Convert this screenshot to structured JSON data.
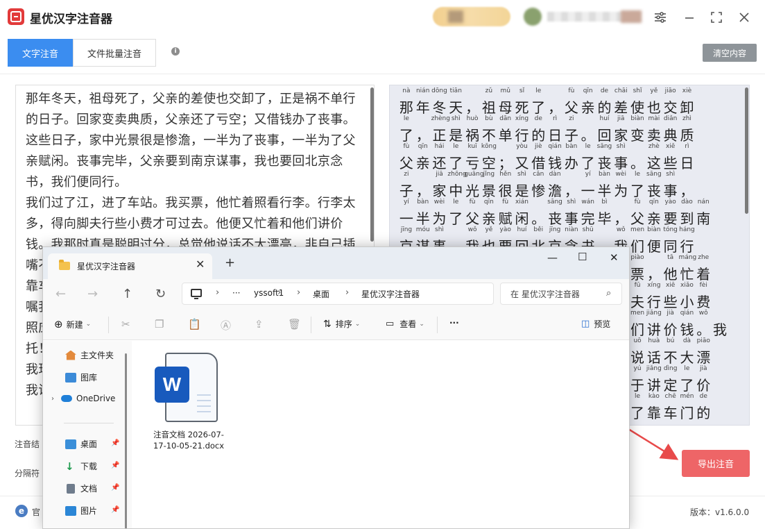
{
  "app": {
    "title": "星优汉字注音器",
    "tabs": [
      {
        "label": "文字注音",
        "active": true
      },
      {
        "label": "文件批量注音",
        "active": false
      }
    ],
    "clear_label": "清空内容",
    "export_label": "导出注音",
    "label_result": "注音结",
    "label_separator": "分隔符",
    "official_site": "官",
    "version": "版本：v1.6.0.0",
    "window_icons": [
      "settings-icon",
      "minimize-icon",
      "maximize-icon",
      "close-icon"
    ],
    "colors": {
      "tab_active": "#3b8df0",
      "export": "#ee6567",
      "clear": "#8e9499",
      "logo": "#e23a3a",
      "annotation_arrow": "#e84a4a"
    }
  },
  "input_text": "那年冬天，祖母死了，父亲的差使也交卸了，正是祸不单行的日子。回家变卖典质，父亲还了亏空；又借钱办了丧事。这些日子，家中光景很是惨澹，一半为了丧事，一半为了父亲赋闲。丧事完毕，父亲要到南京谋事，我也要回北京念书，我们便同行。\n我们过了江，进了车站。我买票，他忙着照看行李。行李太多，得向脚夫行些小费才可过去。他便又忙着和他们讲价钱。我那时真是聪明过分，总觉他说话不大漂亮，非自己插嘴不可。但他终于讲定了价钱；就送我上车。他给我拣定了靠车门的一张椅子；我将他给我做的紫毛大衣铺好座位。他嘱我路上小心，夜里要警醒些，不要受凉。又嘱托茶房好好照应我。我心里暗笑他的迂；他们只认得钱，托他们直是白托！而且我这样大年纪的人，难道还不能料理自己么？唉，我现在想想，那时真是太聪明了。\n我说道：“爸爸，你走吧。”",
  "pinyin_lines": [
    {
      "py": [
        "nà",
        "nián",
        "dōng",
        "tiān",
        "",
        "zǔ",
        "mǔ",
        "sǐ",
        "le",
        "",
        "fù",
        "qīn",
        "de",
        "chāi",
        "shǐ",
        "yě",
        "jiāo",
        "xiè"
      ],
      "hz": [
        "那",
        "年",
        "冬",
        "天",
        "，",
        "祖",
        "母",
        "死",
        "了",
        "，",
        "父",
        "亲",
        "的",
        "差",
        "使",
        "也",
        "交",
        "卸"
      ]
    },
    {
      "py": [
        "le",
        "",
        "zhèng",
        "shì",
        "huò",
        "bù",
        "dān",
        "xíng",
        "de",
        "rì",
        "zi",
        "",
        "huí",
        "jiā",
        "biàn",
        "mài",
        "diǎn",
        "zhì"
      ],
      "hz": [
        "了",
        "，",
        "正",
        "是",
        "祸",
        "不",
        "单",
        "行",
        "的",
        "日",
        "子",
        "。",
        "回",
        "家",
        "变",
        "卖",
        "典",
        "质"
      ]
    },
    {
      "py": [
        "fù",
        "qīn",
        "hái",
        "le",
        "kuī",
        "kōng",
        "",
        "yòu",
        "jiè",
        "qián",
        "bàn",
        "le",
        "sāng",
        "shì",
        "",
        "zhè",
        "xiē",
        "rì"
      ],
      "hz": [
        "父",
        "亲",
        "还",
        "了",
        "亏",
        "空",
        "；",
        "又",
        "借",
        "钱",
        "办",
        "了",
        "丧",
        "事",
        "。",
        "这",
        "些",
        "日"
      ]
    },
    {
      "py": [
        "zi",
        "",
        "jiā",
        "zhōng",
        "guāng",
        "jǐng",
        "hěn",
        "shì",
        "cǎn",
        "dàn",
        "",
        "yí",
        "bàn",
        "wèi",
        "le",
        "sāng",
        "shì",
        ""
      ],
      "hz": [
        "子",
        "，",
        "家",
        "中",
        "光",
        "景",
        "很",
        "是",
        "惨",
        "澹",
        "，",
        "一",
        "半",
        "为",
        "了",
        "丧",
        "事",
        "，"
      ]
    },
    {
      "py": [
        "yí",
        "bàn",
        "wèi",
        "le",
        "fù",
        "qīn",
        "fù",
        "xián",
        "",
        "sāng",
        "shì",
        "wán",
        "bì",
        "",
        "fù",
        "qīn",
        "yào",
        "dào",
        "nán"
      ],
      "hz": [
        "一",
        "半",
        "为",
        "了",
        "父",
        "亲",
        "赋",
        "闲",
        "。",
        "丧",
        "事",
        "完",
        "毕",
        "，",
        "父",
        "亲",
        "要",
        "到",
        "南"
      ]
    },
    {
      "py": [
        "jīng",
        "móu",
        "shì",
        "",
        "wǒ",
        "yě",
        "yào",
        "huí",
        "běi",
        "jīng",
        "niàn",
        "shū",
        "",
        "wǒ",
        "men",
        "biàn",
        "tóng",
        "háng"
      ],
      "hz": [
        "京",
        "谋",
        "事",
        "，",
        "我",
        "也",
        "要",
        "回",
        "北",
        "京",
        "念",
        "书",
        "，",
        "我",
        "们",
        "便",
        "同",
        "行"
      ]
    },
    {
      "py": [
        "",
        "",
        "",
        "",
        "",
        "",
        "",
        "",
        "",
        "",
        "",
        "",
        "",
        "",
        "piào",
        "",
        "tā",
        "máng",
        "zhe"
      ],
      "hz": [
        "",
        "",
        "",
        "",
        "",
        "",
        "",
        "",
        "",
        "",
        "",
        "",
        "",
        "",
        "票",
        "，",
        "他",
        "忙",
        "着"
      ]
    },
    {
      "py": [
        "",
        "",
        "",
        "",
        "",
        "",
        "",
        "",
        "",
        "",
        "",
        "",
        "",
        "",
        "fū",
        "xíng",
        "xiē",
        "xiǎo",
        "fèi"
      ],
      "hz": [
        "",
        "",
        "",
        "",
        "",
        "",
        "",
        "",
        "",
        "",
        "",
        "",
        "",
        "",
        "夫",
        "行",
        "些",
        "小",
        "费"
      ]
    },
    {
      "py": [
        "",
        "",
        "",
        "",
        "",
        "",
        "",
        "",
        "",
        "",
        "",
        "",
        "",
        "",
        "men",
        "jiǎng",
        "jià",
        "qián",
        "wǒ"
      ],
      "hz": [
        "",
        "",
        "",
        "",
        "",
        "",
        "",
        "",
        "",
        "",
        "",
        "",
        "",
        "",
        "们",
        "讲",
        "价",
        "钱",
        "。",
        "我"
      ]
    },
    {
      "py": [
        "",
        "",
        "",
        "",
        "",
        "",
        "",
        "",
        "",
        "",
        "",
        "",
        "",
        "",
        "uō",
        "huà",
        "bú",
        "dà",
        "piāo"
      ],
      "hz": [
        "",
        "",
        "",
        "",
        "",
        "",
        "",
        "",
        "",
        "",
        "",
        "",
        "",
        "",
        "说",
        "话",
        "不",
        "大",
        "漂"
      ]
    },
    {
      "py": [
        "",
        "",
        "",
        "",
        "",
        "",
        "",
        "",
        "",
        "",
        "",
        "",
        "",
        "",
        "yú",
        "jiǎng",
        "dìng",
        "le",
        "jià"
      ],
      "hz": [
        "",
        "",
        "",
        "",
        "",
        "",
        "",
        "",
        "",
        "",
        "",
        "",
        "",
        "",
        "于",
        "讲",
        "定",
        "了",
        "价"
      ]
    },
    {
      "py": [
        "",
        "",
        "",
        "",
        "",
        "",
        "",
        "",
        "",
        "",
        "",
        "",
        "",
        "",
        "le",
        "kào",
        "chē",
        "mén",
        "de"
      ],
      "hz": [
        "",
        "",
        "",
        "",
        "",
        "",
        "",
        "",
        "",
        "",
        "",
        "",
        "",
        "",
        "了",
        "靠",
        "车",
        "门",
        "的"
      ]
    }
  ],
  "explorer": {
    "tab_title": "星优汉字注音器",
    "breadcrumb": [
      "yssoft1",
      "桌面",
      "星优汉字注音器"
    ],
    "more_crumbs": "···",
    "search_placeholder": "在 星优汉字注音器",
    "new_label": "新建",
    "sort_label": "排序",
    "view_label": "查看",
    "more_label": "···",
    "preview_label": "预览",
    "nav": [
      {
        "label": "主文件夹",
        "icon": "home-icon"
      },
      {
        "label": "图库",
        "icon": "gallery-icon"
      },
      {
        "label": "OneDrive",
        "icon": "cloud-icon"
      },
      {
        "label": "桌面",
        "icon": "desktop-icon"
      },
      {
        "label": "下载",
        "icon": "download-icon"
      },
      {
        "label": "文档",
        "icon": "document-icon"
      },
      {
        "label": "图片",
        "icon": "picture-icon"
      }
    ],
    "file": {
      "name": "注音文档 2026-07-17-10-05-21.docx",
      "icon": "word-file-icon"
    }
  }
}
